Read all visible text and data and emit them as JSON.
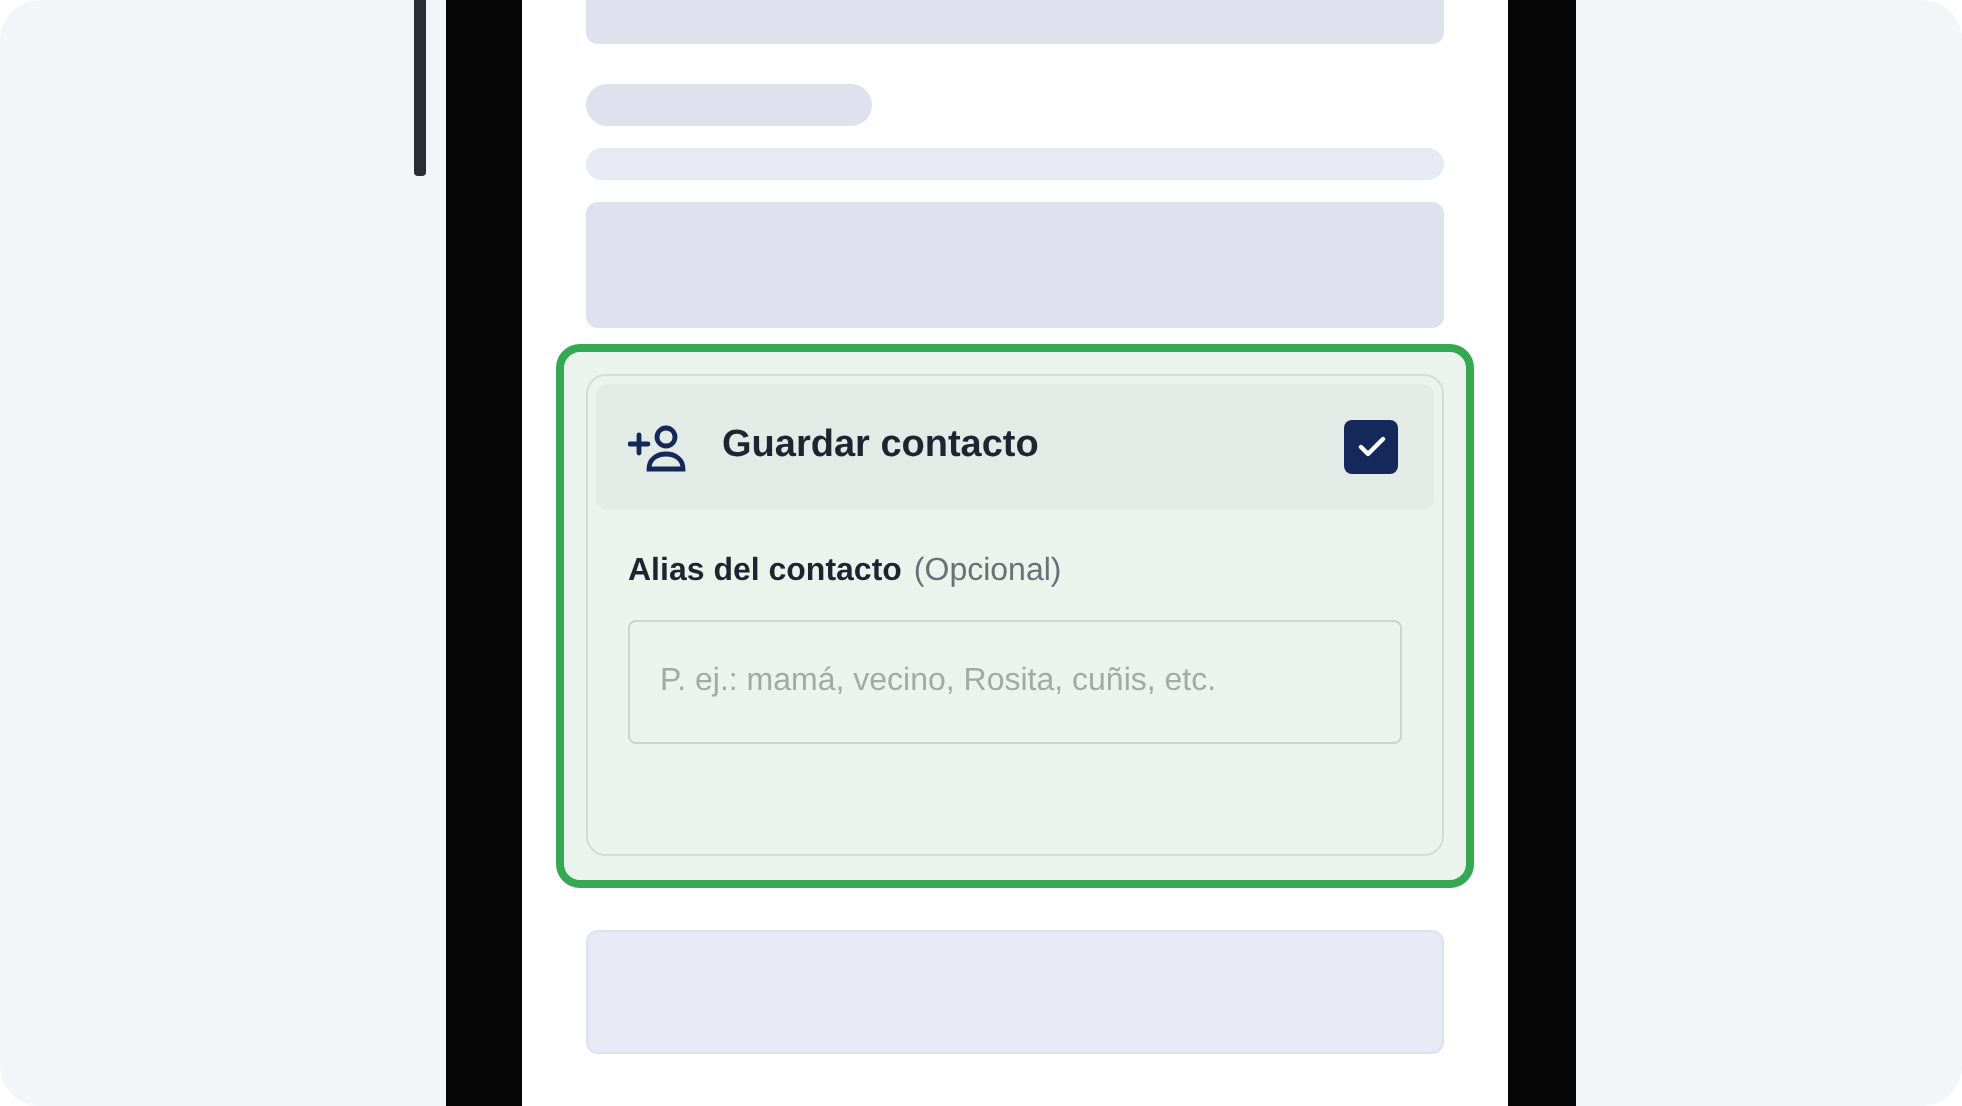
{
  "save_contact": {
    "title": "Guardar contacto",
    "checked": true
  },
  "alias_field": {
    "label": "Alias del contacto",
    "hint": "(Opcional)",
    "placeholder": "P. ej.: mamá, vecino, Rosita, cuñis, etc."
  }
}
